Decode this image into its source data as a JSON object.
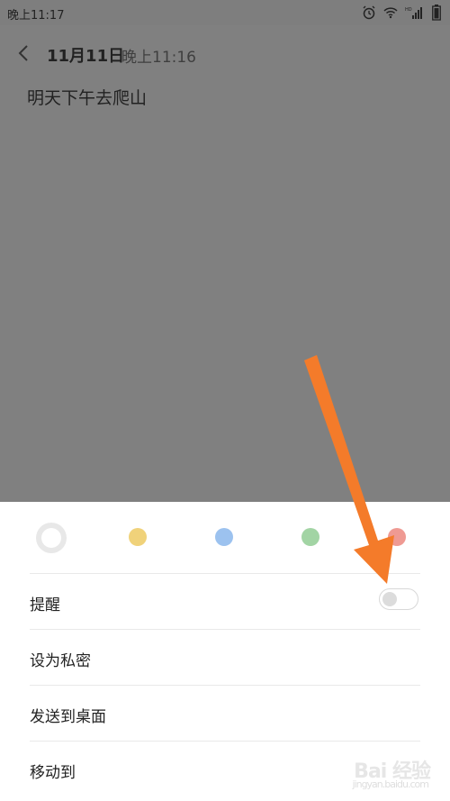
{
  "status_bar": {
    "time": "晚上11:17",
    "icons": [
      "alarm-icon",
      "wifi-icon",
      "hd-signal-icon",
      "battery-icon"
    ]
  },
  "header": {
    "date": "11月11日",
    "time": "晚上11:16"
  },
  "note": {
    "text": "明天下午去爬山"
  },
  "sheet": {
    "colors": [
      {
        "name": "white",
        "hex": "#ffffff",
        "selected": true
      },
      {
        "name": "yellow",
        "hex": "#f0d27a"
      },
      {
        "name": "blue",
        "hex": "#9cc2ef"
      },
      {
        "name": "green",
        "hex": "#a2d4a4"
      },
      {
        "name": "red",
        "hex": "#ef9a93"
      }
    ],
    "items": [
      {
        "label": "提醒",
        "toggle": false
      },
      {
        "label": "设为私密"
      },
      {
        "label": "发送到桌面"
      },
      {
        "label": "移动到"
      }
    ]
  },
  "annotation": {
    "arrow_color": "#f47b2a"
  },
  "watermark": {
    "text": "Bai 经验",
    "sub": "jingyan.baidu.com"
  }
}
